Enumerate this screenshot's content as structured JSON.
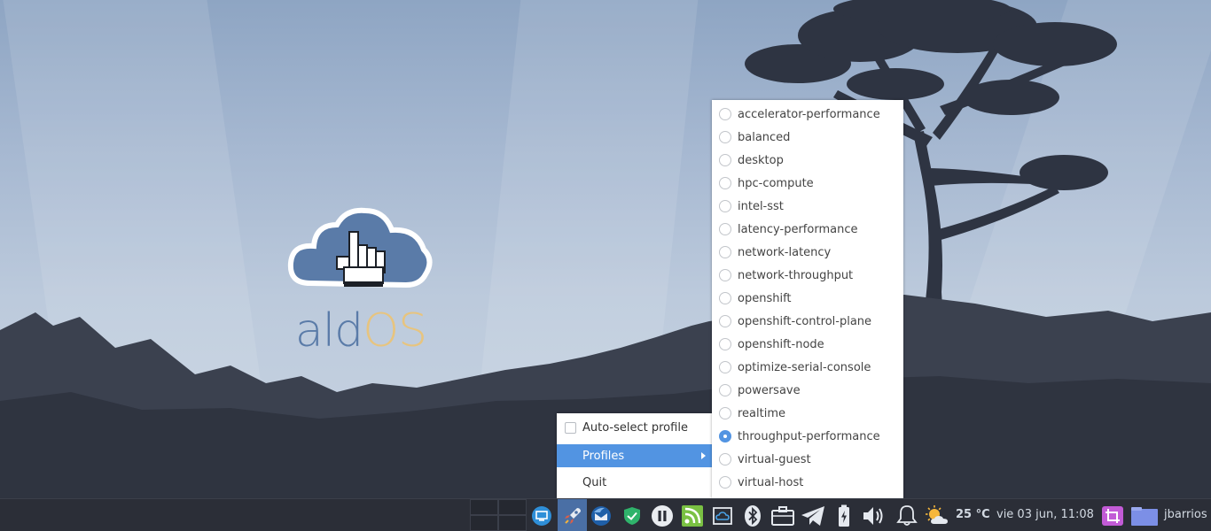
{
  "desktop": {
    "logo_text_ald": "ald",
    "logo_text_os": "OS"
  },
  "context_menu": {
    "items": [
      {
        "label": "Auto-select profile",
        "type": "checkbox",
        "checked": false
      },
      {
        "label": "Profiles",
        "type": "submenu",
        "highlighted": true
      },
      {
        "label": "Quit",
        "type": "action"
      }
    ]
  },
  "profiles_submenu": {
    "selected": "throughput-performance",
    "items": [
      {
        "label": "accelerator-performance",
        "checked": false
      },
      {
        "label": "balanced",
        "checked": false
      },
      {
        "label": "desktop",
        "checked": false
      },
      {
        "label": "hpc-compute",
        "checked": false
      },
      {
        "label": "intel-sst",
        "checked": false
      },
      {
        "label": "latency-performance",
        "checked": false
      },
      {
        "label": "network-latency",
        "checked": false
      },
      {
        "label": "network-throughput",
        "checked": false
      },
      {
        "label": "openshift",
        "checked": false
      },
      {
        "label": "openshift-control-plane",
        "checked": false
      },
      {
        "label": "openshift-node",
        "checked": false
      },
      {
        "label": "optimize-serial-console",
        "checked": false
      },
      {
        "label": "powersave",
        "checked": false
      },
      {
        "label": "realtime",
        "checked": false
      },
      {
        "label": "throughput-performance",
        "checked": true
      },
      {
        "label": "virtual-guest",
        "checked": false
      },
      {
        "label": "virtual-host",
        "checked": false
      }
    ]
  },
  "panel": {
    "tray_icons": [
      "display-icon",
      "tuned-rocket-icon",
      "thunderbird-icon",
      "shield-check-icon",
      "pause-icon",
      "feed-icon",
      "cloud-sync-icon",
      "bluetooth-icon",
      "briefcase-icon",
      "telegram-icon",
      "battery-icon",
      "volume-icon",
      "bell-icon"
    ],
    "weather": {
      "icon": "partly-sunny-icon",
      "temperature": "25 °C"
    },
    "clock": "vie 03 jun, 11:08",
    "screenshot_icon": "crop-icon",
    "user_icon": "user-folder-icon",
    "username": "jbarrios"
  },
  "colors": {
    "accent": "#5294e2",
    "panel_bg": "#2b2e37",
    "active_tray_bg": "#4a6fa5",
    "logo_blue": "#5a7ba8",
    "logo_gold": "#e7c47f"
  }
}
